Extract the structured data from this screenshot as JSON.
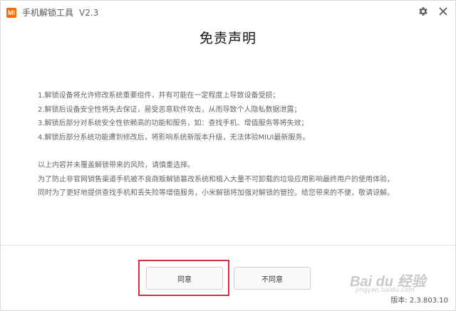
{
  "window": {
    "logo_text": "MI",
    "app_name": "手机解锁工具",
    "app_version": "V2.3",
    "icons": [
      "gear-icon",
      "close-icon"
    ]
  },
  "page_title": "免责声明",
  "disclaimer": {
    "items": [
      "1.解锁设备将允许修改系统重要组件，并有可能在一定程度上导致设备受损；",
      "2.解锁后设备安全性将失去保证，易受恶意软件攻击，从而导致个人隐私数据泄露；",
      "3.解锁后部分对系统安全性依赖高的功能和服务，如：查找手机、增值服务等将失效；",
      "4.解锁后部分系统功能遭到修改后，将影响系统新版本升级，无法体验MIUI最新服务。"
    ],
    "notice": [
      "以上内容并未覆盖解锁带来的风险，请慎重选择。",
      "为了防止非官网销售渠道手机被不良商贩解锁篡改系统和植入大量不可卸载的垃圾应用影响最终用户的使用体验，",
      "同时为了更好地提供查找手机和丢失险等增值服务，小米解锁将加强对解锁的管控。给您带来的不便，敬请谅解。"
    ]
  },
  "buttons": {
    "agree": "同意",
    "disagree": "不同意"
  },
  "watermark": {
    "text": "Bai du 经验",
    "sub": "jingyan.baidu.com"
  },
  "footer": {
    "version": "版本: 2.3.803.10"
  },
  "colors": {
    "accent": "#ff6700",
    "highlight": "#d0303a"
  }
}
